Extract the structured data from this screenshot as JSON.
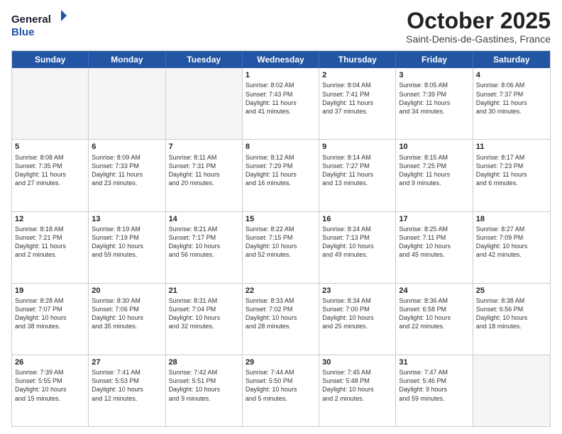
{
  "header": {
    "logo_general": "General",
    "logo_blue": "Blue",
    "month_title": "October 2025",
    "subtitle": "Saint-Denis-de-Gastines, France"
  },
  "days_of_week": [
    "Sunday",
    "Monday",
    "Tuesday",
    "Wednesday",
    "Thursday",
    "Friday",
    "Saturday"
  ],
  "weeks": [
    [
      {
        "num": "",
        "info": "",
        "empty": true
      },
      {
        "num": "",
        "info": "",
        "empty": true
      },
      {
        "num": "",
        "info": "",
        "empty": true
      },
      {
        "num": "1",
        "info": "Sunrise: 8:02 AM\nSunset: 7:43 PM\nDaylight: 11 hours\nand 41 minutes.",
        "empty": false
      },
      {
        "num": "2",
        "info": "Sunrise: 8:04 AM\nSunset: 7:41 PM\nDaylight: 11 hours\nand 37 minutes.",
        "empty": false
      },
      {
        "num": "3",
        "info": "Sunrise: 8:05 AM\nSunset: 7:39 PM\nDaylight: 11 hours\nand 34 minutes.",
        "empty": false
      },
      {
        "num": "4",
        "info": "Sunrise: 8:06 AM\nSunset: 7:37 PM\nDaylight: 11 hours\nand 30 minutes.",
        "empty": false
      }
    ],
    [
      {
        "num": "5",
        "info": "Sunrise: 8:08 AM\nSunset: 7:35 PM\nDaylight: 11 hours\nand 27 minutes.",
        "empty": false
      },
      {
        "num": "6",
        "info": "Sunrise: 8:09 AM\nSunset: 7:33 PM\nDaylight: 11 hours\nand 23 minutes.",
        "empty": false
      },
      {
        "num": "7",
        "info": "Sunrise: 8:11 AM\nSunset: 7:31 PM\nDaylight: 11 hours\nand 20 minutes.",
        "empty": false
      },
      {
        "num": "8",
        "info": "Sunrise: 8:12 AM\nSunset: 7:29 PM\nDaylight: 11 hours\nand 16 minutes.",
        "empty": false
      },
      {
        "num": "9",
        "info": "Sunrise: 8:14 AM\nSunset: 7:27 PM\nDaylight: 11 hours\nand 13 minutes.",
        "empty": false
      },
      {
        "num": "10",
        "info": "Sunrise: 8:15 AM\nSunset: 7:25 PM\nDaylight: 11 hours\nand 9 minutes.",
        "empty": false
      },
      {
        "num": "11",
        "info": "Sunrise: 8:17 AM\nSunset: 7:23 PM\nDaylight: 11 hours\nand 6 minutes.",
        "empty": false
      }
    ],
    [
      {
        "num": "12",
        "info": "Sunrise: 8:18 AM\nSunset: 7:21 PM\nDaylight: 11 hours\nand 2 minutes.",
        "empty": false
      },
      {
        "num": "13",
        "info": "Sunrise: 8:19 AM\nSunset: 7:19 PM\nDaylight: 10 hours\nand 59 minutes.",
        "empty": false
      },
      {
        "num": "14",
        "info": "Sunrise: 8:21 AM\nSunset: 7:17 PM\nDaylight: 10 hours\nand 56 minutes.",
        "empty": false
      },
      {
        "num": "15",
        "info": "Sunrise: 8:22 AM\nSunset: 7:15 PM\nDaylight: 10 hours\nand 52 minutes.",
        "empty": false
      },
      {
        "num": "16",
        "info": "Sunrise: 8:24 AM\nSunset: 7:13 PM\nDaylight: 10 hours\nand 49 minutes.",
        "empty": false
      },
      {
        "num": "17",
        "info": "Sunrise: 8:25 AM\nSunset: 7:11 PM\nDaylight: 10 hours\nand 45 minutes.",
        "empty": false
      },
      {
        "num": "18",
        "info": "Sunrise: 8:27 AM\nSunset: 7:09 PM\nDaylight: 10 hours\nand 42 minutes.",
        "empty": false
      }
    ],
    [
      {
        "num": "19",
        "info": "Sunrise: 8:28 AM\nSunset: 7:07 PM\nDaylight: 10 hours\nand 38 minutes.",
        "empty": false
      },
      {
        "num": "20",
        "info": "Sunrise: 8:30 AM\nSunset: 7:06 PM\nDaylight: 10 hours\nand 35 minutes.",
        "empty": false
      },
      {
        "num": "21",
        "info": "Sunrise: 8:31 AM\nSunset: 7:04 PM\nDaylight: 10 hours\nand 32 minutes.",
        "empty": false
      },
      {
        "num": "22",
        "info": "Sunrise: 8:33 AM\nSunset: 7:02 PM\nDaylight: 10 hours\nand 28 minutes.",
        "empty": false
      },
      {
        "num": "23",
        "info": "Sunrise: 8:34 AM\nSunset: 7:00 PM\nDaylight: 10 hours\nand 25 minutes.",
        "empty": false
      },
      {
        "num": "24",
        "info": "Sunrise: 8:36 AM\nSunset: 6:58 PM\nDaylight: 10 hours\nand 22 minutes.",
        "empty": false
      },
      {
        "num": "25",
        "info": "Sunrise: 8:38 AM\nSunset: 6:56 PM\nDaylight: 10 hours\nand 18 minutes.",
        "empty": false
      }
    ],
    [
      {
        "num": "26",
        "info": "Sunrise: 7:39 AM\nSunset: 5:55 PM\nDaylight: 10 hours\nand 15 minutes.",
        "empty": false
      },
      {
        "num": "27",
        "info": "Sunrise: 7:41 AM\nSunset: 5:53 PM\nDaylight: 10 hours\nand 12 minutes.",
        "empty": false
      },
      {
        "num": "28",
        "info": "Sunrise: 7:42 AM\nSunset: 5:51 PM\nDaylight: 10 hours\nand 9 minutes.",
        "empty": false
      },
      {
        "num": "29",
        "info": "Sunrise: 7:44 AM\nSunset: 5:50 PM\nDaylight: 10 hours\nand 5 minutes.",
        "empty": false
      },
      {
        "num": "30",
        "info": "Sunrise: 7:45 AM\nSunset: 5:48 PM\nDaylight: 10 hours\nand 2 minutes.",
        "empty": false
      },
      {
        "num": "31",
        "info": "Sunrise: 7:47 AM\nSunset: 5:46 PM\nDaylight: 9 hours\nand 59 minutes.",
        "empty": false
      },
      {
        "num": "",
        "info": "",
        "empty": true
      }
    ]
  ]
}
